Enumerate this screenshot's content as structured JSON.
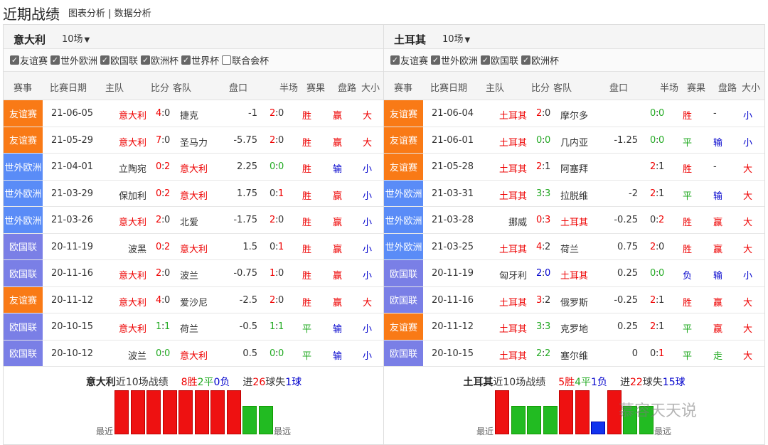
{
  "page": {
    "title": "近期战绩",
    "link_chart": "图表分析",
    "sep": "|",
    "link_data": "数据分析"
  },
  "colors": {
    "friendly": "#f97a16",
    "wc_euro": "#5a8cf7",
    "nations": "#7a7fe6",
    "win": "#e11",
    "draw": "#2b2",
    "loss": "#13e"
  },
  "headers": [
    "赛事",
    "比赛日期",
    "主队",
    "比分",
    "客队",
    "盘口",
    "半场",
    "赛果",
    "盘路",
    "大小"
  ],
  "watermark": "慕容天天说",
  "left": {
    "team": "意大利",
    "count": "10场",
    "filters": [
      {
        "label": "友谊赛",
        "checked": "✓"
      },
      {
        "label": "世外欧洲",
        "checked": "✓"
      },
      {
        "label": "欧国联",
        "checked": "✓"
      },
      {
        "label": "欧洲杯",
        "checked": "✓"
      },
      {
        "label": "世界杯",
        "checked": "✓"
      },
      {
        "label": "联合会杯",
        "checked": ""
      }
    ],
    "rows": [
      {
        "league": "友谊赛",
        "lc": "#f97a16",
        "date": "21-06-05",
        "home": "意大利",
        "hc": "red",
        "s1": "4",
        "s2": "0",
        "s1c": "red",
        "away": "捷克",
        "ac": "dark",
        "line": "-1",
        "h1": "2",
        "h2": "0",
        "h1c": "red",
        "res": "胜",
        "rc": "red",
        "pan": "赢",
        "pc": "red",
        "ou": "大",
        "oc": "red"
      },
      {
        "league": "友谊赛",
        "lc": "#f97a16",
        "date": "21-05-29",
        "home": "意大利",
        "hc": "red",
        "s1": "7",
        "s2": "0",
        "s1c": "red",
        "away": "圣马力",
        "ac": "dark",
        "line": "-5.75",
        "h1": "2",
        "h2": "0",
        "h1c": "red",
        "res": "胜",
        "rc": "red",
        "pan": "赢",
        "pc": "red",
        "ou": "大",
        "oc": "red"
      },
      {
        "league": "世外欧洲",
        "lc": "#5a8cf7",
        "date": "21-04-01",
        "home": "立陶宛",
        "hc": "dark",
        "s1": "0",
        "s2": "2",
        "s1c": "red2",
        "away": "意大利",
        "ac": "red",
        "line": "2.25",
        "h1": "0",
        "h2": "0",
        "h1c": "green",
        "res": "胜",
        "rc": "red",
        "pan": "输",
        "pc": "blue",
        "ou": "小",
        "oc": "blue"
      },
      {
        "league": "世外欧洲",
        "lc": "#5a8cf7",
        "date": "21-03-29",
        "home": "保加利",
        "hc": "dark",
        "s1": "0",
        "s2": "2",
        "s1c": "red2",
        "away": "意大利",
        "ac": "red",
        "line": "1.75",
        "h1": "0",
        "h2": "1",
        "h1c": "red2",
        "res": "胜",
        "rc": "red",
        "pan": "赢",
        "pc": "red",
        "ou": "小",
        "oc": "blue"
      },
      {
        "league": "世外欧洲",
        "lc": "#5a8cf7",
        "date": "21-03-26",
        "home": "意大利",
        "hc": "red",
        "s1": "2",
        "s2": "0",
        "s1c": "red",
        "away": "北爱",
        "ac": "dark",
        "line": "-1.75",
        "h1": "2",
        "h2": "0",
        "h1c": "red",
        "res": "胜",
        "rc": "red",
        "pan": "赢",
        "pc": "red",
        "ou": "小",
        "oc": "blue"
      },
      {
        "league": "欧国联",
        "lc": "#7a7fe6",
        "date": "20-11-19",
        "home": "波黑",
        "hc": "dark",
        "s1": "0",
        "s2": "2",
        "s1c": "red2",
        "away": "意大利",
        "ac": "red",
        "line": "1.5",
        "h1": "0",
        "h2": "1",
        "h1c": "red2",
        "res": "胜",
        "rc": "red",
        "pan": "赢",
        "pc": "red",
        "ou": "小",
        "oc": "blue"
      },
      {
        "league": "欧国联",
        "lc": "#7a7fe6",
        "date": "20-11-16",
        "home": "意大利",
        "hc": "red",
        "s1": "2",
        "s2": "0",
        "s1c": "red",
        "away": "波兰",
        "ac": "dark",
        "line": "-0.75",
        "h1": "1",
        "h2": "0",
        "h1c": "red",
        "res": "胜",
        "rc": "red",
        "pan": "赢",
        "pc": "red",
        "ou": "小",
        "oc": "blue"
      },
      {
        "league": "友谊赛",
        "lc": "#f97a16",
        "date": "20-11-12",
        "home": "意大利",
        "hc": "red",
        "s1": "4",
        "s2": "0",
        "s1c": "red",
        "away": "爱沙尼",
        "ac": "dark",
        "line": "-2.5",
        "h1": "2",
        "h2": "0",
        "h1c": "red",
        "res": "胜",
        "rc": "red",
        "pan": "赢",
        "pc": "red",
        "ou": "大",
        "oc": "red"
      },
      {
        "league": "欧国联",
        "lc": "#7a7fe6",
        "date": "20-10-15",
        "home": "意大利",
        "hc": "red",
        "s1": "1",
        "s2": "1",
        "s1c": "green",
        "away": "荷兰",
        "ac": "dark",
        "line": "-0.5",
        "h1": "1",
        "h2": "1",
        "h1c": "green",
        "res": "平",
        "rc": "green",
        "pan": "输",
        "pc": "blue",
        "ou": "小",
        "oc": "blue"
      },
      {
        "league": "欧国联",
        "lc": "#7a7fe6",
        "date": "20-10-12",
        "home": "波兰",
        "hc": "dark",
        "s1": "0",
        "s2": "0",
        "s1c": "green",
        "away": "意大利",
        "ac": "red",
        "line": "0.5",
        "h1": "0",
        "h2": "0",
        "h1c": "green",
        "res": "平",
        "rc": "green",
        "pan": "输",
        "pc": "blue",
        "ou": "小",
        "oc": "blue"
      }
    ],
    "summary": {
      "team": "意大利",
      "text": "近10场战绩",
      "w": "8",
      "wl": "胜",
      "d": "2",
      "dl": "平",
      "l": "0",
      "ll": "负",
      "in_l": "进",
      "in": "26",
      "mid": "球失",
      "out": "1",
      "end": "球"
    },
    "form": [
      "W",
      "W",
      "W",
      "W",
      "W",
      "W",
      "W",
      "W",
      "D",
      "D"
    ],
    "recent": "最近",
    "far": "最远"
  },
  "right": {
    "team": "土耳其",
    "count": "10场",
    "filters": [
      {
        "label": "友谊赛",
        "checked": "✓"
      },
      {
        "label": "世外欧洲",
        "checked": "✓"
      },
      {
        "label": "欧国联",
        "checked": "✓"
      },
      {
        "label": "欧洲杯",
        "checked": "✓"
      }
    ],
    "rows": [
      {
        "league": "友谊赛",
        "lc": "#f97a16",
        "date": "21-06-04",
        "home": "土耳其",
        "hc": "red",
        "s1": "2",
        "s2": "0",
        "s1c": "red",
        "away": "摩尔多",
        "ac": "dark",
        "line": "",
        "h1": "0",
        "h2": "0",
        "h1c": "green",
        "res": "胜",
        "rc": "red",
        "pan": "-",
        "pc": "dark",
        "ou": "小",
        "oc": "blue"
      },
      {
        "league": "友谊赛",
        "lc": "#f97a16",
        "date": "21-06-01",
        "home": "土耳其",
        "hc": "red",
        "s1": "0",
        "s2": "0",
        "s1c": "green",
        "away": "几内亚",
        "ac": "dark",
        "line": "-1.25",
        "h1": "0",
        "h2": "0",
        "h1c": "green",
        "res": "平",
        "rc": "green",
        "pan": "输",
        "pc": "blue",
        "ou": "小",
        "oc": "blue"
      },
      {
        "league": "友谊赛",
        "lc": "#f97a16",
        "date": "21-05-28",
        "home": "土耳其",
        "hc": "red",
        "s1": "2",
        "s2": "1",
        "s1c": "red",
        "away": "阿塞拜",
        "ac": "dark",
        "line": "",
        "h1": "2",
        "h2": "1",
        "h1c": "red",
        "res": "胜",
        "rc": "red",
        "pan": "-",
        "pc": "dark",
        "ou": "大",
        "oc": "red"
      },
      {
        "league": "世外欧洲",
        "lc": "#5a8cf7",
        "date": "21-03-31",
        "home": "土耳其",
        "hc": "red",
        "s1": "3",
        "s2": "3",
        "s1c": "green",
        "away": "拉脱维",
        "ac": "dark",
        "line": "-2",
        "h1": "2",
        "h2": "1",
        "h1c": "red",
        "res": "平",
        "rc": "green",
        "pan": "输",
        "pc": "blue",
        "ou": "大",
        "oc": "red"
      },
      {
        "league": "世外欧洲",
        "lc": "#5a8cf7",
        "date": "21-03-28",
        "home": "挪威",
        "hc": "dark",
        "s1": "0",
        "s2": "3",
        "s1c": "red2",
        "away": "土耳其",
        "ac": "red",
        "line": "-0.25",
        "h1": "0",
        "h2": "2",
        "h1c": "red2",
        "res": "胜",
        "rc": "red",
        "pan": "赢",
        "pc": "red",
        "ou": "大",
        "oc": "red"
      },
      {
        "league": "世外欧洲",
        "lc": "#5a8cf7",
        "date": "21-03-25",
        "home": "土耳其",
        "hc": "red",
        "s1": "4",
        "s2": "2",
        "s1c": "red",
        "away": "荷兰",
        "ac": "dark",
        "line": "0.75",
        "h1": "2",
        "h2": "0",
        "h1c": "red",
        "res": "胜",
        "rc": "red",
        "pan": "赢",
        "pc": "red",
        "ou": "大",
        "oc": "red"
      },
      {
        "league": "欧国联",
        "lc": "#7a7fe6",
        "date": "20-11-19",
        "home": "匈牙利",
        "hc": "dark",
        "s1": "2",
        "s2": "0",
        "s1c": "blue",
        "away": "土耳其",
        "ac": "red",
        "line": "0.25",
        "h1": "0",
        "h2": "0",
        "h1c": "green",
        "res": "负",
        "rc": "blue",
        "pan": "输",
        "pc": "blue",
        "ou": "小",
        "oc": "blue"
      },
      {
        "league": "欧国联",
        "lc": "#7a7fe6",
        "date": "20-11-16",
        "home": "土耳其",
        "hc": "red",
        "s1": "3",
        "s2": "2",
        "s1c": "red",
        "away": "俄罗斯",
        "ac": "dark",
        "line": "-0.25",
        "h1": "2",
        "h2": "1",
        "h1c": "red",
        "res": "胜",
        "rc": "red",
        "pan": "赢",
        "pc": "red",
        "ou": "大",
        "oc": "red"
      },
      {
        "league": "友谊赛",
        "lc": "#f97a16",
        "date": "20-11-12",
        "home": "土耳其",
        "hc": "red",
        "s1": "3",
        "s2": "3",
        "s1c": "green",
        "away": "克罗地",
        "ac": "dark",
        "line": "0.25",
        "h1": "2",
        "h2": "1",
        "h1c": "red",
        "res": "平",
        "rc": "green",
        "pan": "赢",
        "pc": "red",
        "ou": "大",
        "oc": "red"
      },
      {
        "league": "欧国联",
        "lc": "#7a7fe6",
        "date": "20-10-15",
        "home": "土耳其",
        "hc": "red",
        "s1": "2",
        "s2": "2",
        "s1c": "green",
        "away": "塞尔维",
        "ac": "dark",
        "line": "0",
        "h1": "0",
        "h2": "1",
        "h1c": "red2",
        "res": "平",
        "rc": "green",
        "pan": "走",
        "pc": "green",
        "ou": "大",
        "oc": "red"
      }
    ],
    "summary": {
      "team": "土耳其",
      "text": "近10场战绩",
      "w": "5",
      "wl": "胜",
      "d": "4",
      "dl": "平",
      "l": "1",
      "ll": "负",
      "in_l": "进",
      "in": "22",
      "mid": "球失",
      "out": "15",
      "end": "球"
    },
    "form": [
      "W",
      "D",
      "D",
      "D",
      "W",
      "W",
      "L",
      "W",
      "D",
      "D"
    ],
    "recent": "最近",
    "far": "最远"
  }
}
